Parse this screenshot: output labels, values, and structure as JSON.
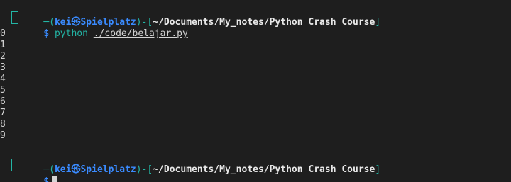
{
  "prompt": {
    "user": "kei",
    "at_symbol": "㉿",
    "host": "Spielplatz",
    "path": "~/Documents/My_notes/Python Crash Course",
    "dollar": "$"
  },
  "command": {
    "program": "python",
    "argument": "./code/belajar.py"
  },
  "output": [
    "0",
    "1",
    "2",
    "3",
    "4",
    "5",
    "6",
    "7",
    "8",
    "9"
  ],
  "prompt2": {
    "user": "kei",
    "at_symbol": "㉿",
    "host": "Spielplatz",
    "path": "~/Documents/My_notes/Python Crash Course",
    "dollar": "$"
  },
  "colors": {
    "background": "#1e1e1e",
    "frame": "#23b5a5",
    "user_host": "#3a8bff",
    "path": "#e8e8e8",
    "text": "#d4d4d4"
  }
}
